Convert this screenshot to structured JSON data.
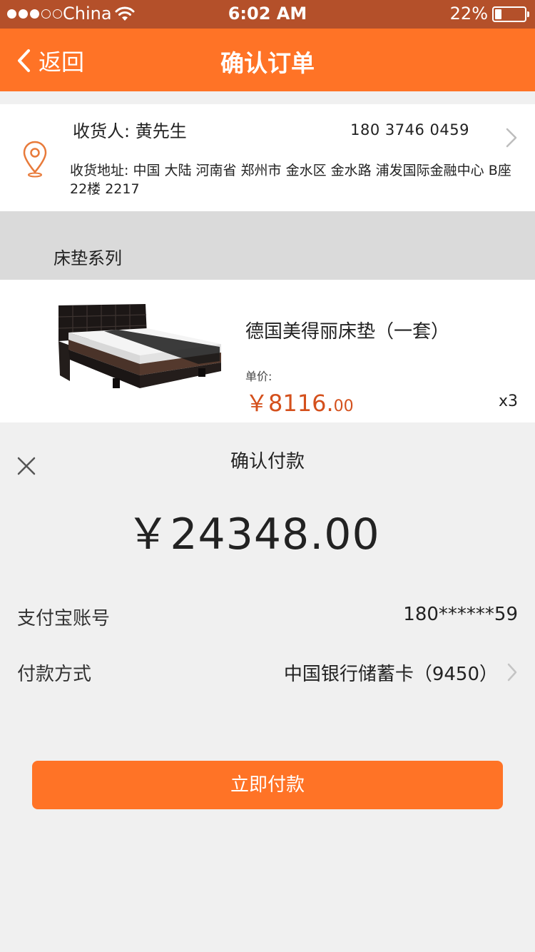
{
  "status_bar": {
    "carrier": "China",
    "time": "6:02 AM",
    "battery_percent_label": "22%",
    "battery_level": 0.22,
    "signal_bars": 3,
    "signal_total": 5
  },
  "nav": {
    "back_label": "返回",
    "title": "确认订单"
  },
  "address": {
    "recipient": "收货人: 黄先生",
    "phone": "180 3746 0459",
    "full_address": "收货地址:  中国  大陆  河南省  郑州市  金水区  金水路  浦发国际金融中心  B座  22楼  2217"
  },
  "section": {
    "title": "床垫系列"
  },
  "product": {
    "name": "德国美得丽床垫（一套）",
    "price_label": "单价:",
    "price_integer": "￥8116.",
    "price_decimal": "00",
    "quantity": "x3"
  },
  "payment": {
    "title": "确认付款",
    "amount": "￥24348.00",
    "account_label": "支付宝账号",
    "account_value": "180******59",
    "method_label": "付款方式",
    "method_value": "中国银行储蓄卡（9450）",
    "pay_button": "立即付款"
  },
  "colors": {
    "status_bar": "#b4502a",
    "accent": "#ff7326",
    "price": "#d4501c",
    "background": "#f0f0f0",
    "section_header": "#dadada"
  },
  "icons": {
    "back": "chevron-left-icon",
    "location": "location-pin-icon",
    "address_arrow": "chevron-right-icon",
    "close": "close-icon",
    "method_arrow": "chevron-right-icon",
    "wifi": "wifi-icon",
    "battery": "battery-icon"
  }
}
